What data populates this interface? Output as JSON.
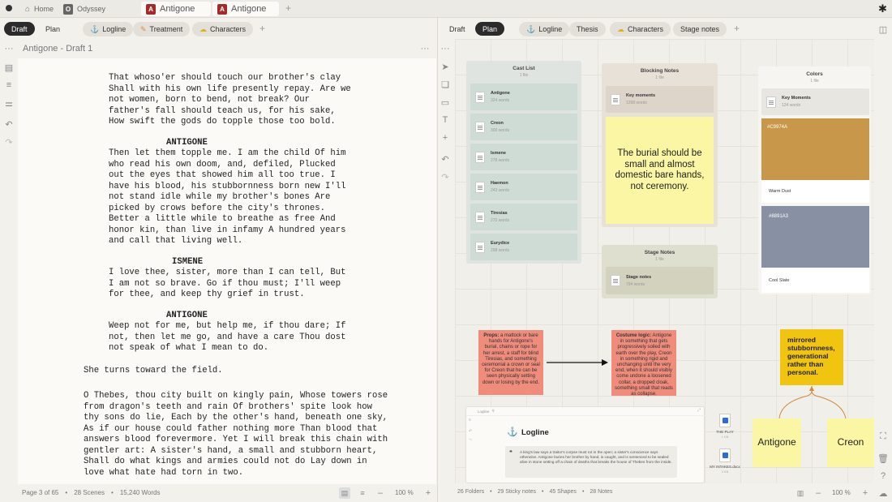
{
  "titlebar": {
    "tabs": [
      {
        "label": "Home",
        "icon": "home-icon"
      },
      {
        "label": "Odyssey",
        "icon": "o-doc-icon",
        "badge": "O"
      },
      {
        "label": "Antigone",
        "icon": "a-doc-icon",
        "badge": "A"
      },
      {
        "label": "Antigone",
        "icon": "a-doc-icon",
        "badge": "A"
      }
    ],
    "new_tab": "+"
  },
  "left_bar": {
    "draft": "Draft",
    "plan": "Plan",
    "tabs": [
      {
        "label": "Logline",
        "icon": "anchor-icon"
      },
      {
        "label": "Treatment",
        "icon": "pen-icon"
      },
      {
        "label": "Characters",
        "icon": "characters-icon"
      }
    ],
    "add": "+"
  },
  "right_bar": {
    "draft": "Draft",
    "plan": "Plan",
    "tabs": [
      {
        "label": "Logline",
        "icon": "anchor-icon"
      },
      {
        "label": "Thesis"
      },
      {
        "label": "Characters",
        "icon": "characters-icon"
      },
      {
        "label": "Stage notes"
      }
    ],
    "add": "+"
  },
  "editor": {
    "title": "Antigone - Draft 1",
    "blocks": [
      {
        "type": "dialogue",
        "text": "That whoso'er should touch our brother's clay\nShall with his own life presently repay. Are we\nnot women, born to bend, not break? Our\nfather's fall should teach us, for his sake,\nHow swift the gods do topple those too bold."
      },
      {
        "type": "character",
        "text": "ANTIGONE"
      },
      {
        "type": "dialogue",
        "text": "Then let them topple me. I am the child Of him\nwho read his own doom, and, defiled, Plucked\nout the eyes that showed him all too true. I\nhave his blood, his stubbornness born new I'll\nnot stand idle while my brother's bones Are\npicked by crows before the city's thrones.\nBetter a little while to breathe as free And\nhonor kin, than live in infamy A hundred years\nand call that living well."
      },
      {
        "type": "character",
        "text": "ISMENE"
      },
      {
        "type": "dialogue",
        "text": "I love thee, sister, more than I can tell, But\nI am not so brave. Go if thou must; I'll weep\nfor thee, and keep thy grief in trust."
      },
      {
        "type": "character",
        "text": "ANTIGONE"
      },
      {
        "type": "dialogue",
        "text": "Weep not for me, but help me, if thou dare; If\nnot, then let me go, and have a care Thou dost\nnot speak of what I mean to do."
      },
      {
        "type": "action",
        "text": "She turns toward the field."
      },
      {
        "type": "action",
        "text": "O Thebes, thou city built on kingly pain, Whose towers rose\nfrom dragon's teeth and rain Of brothers' spite look how\nthy sons do lie, Each by the other's hand, beneath one sky,\nAs if our house could father nothing more Than blood that\nanswers blood forevermore. Yet I will break this chain with\ngentler art: A sister's hand, a small and stubborn heart,\nShall do what kings and armies could not do Lay down in\nlove what hate had torn in two."
      }
    ]
  },
  "left_status": {
    "page": "Page 3 of 65",
    "scenes": "28 Scenes",
    "words": "15,240 Words",
    "zoom": "100 %"
  },
  "right_status": {
    "folders": "26 Folders",
    "sticky": "29 Sticky notes",
    "shapes": "45 Shapes",
    "notes": "28 Notes",
    "zoom": "100 %"
  },
  "canvas": {
    "cast_list": {
      "title": "Cast List",
      "sub": "1 file",
      "items": [
        {
          "name": "Antigone",
          "meta": "324 words"
        },
        {
          "name": "Creon",
          "meta": "300 words"
        },
        {
          "name": "Ismene",
          "meta": "278 words"
        },
        {
          "name": "Haemon",
          "meta": "243 words"
        },
        {
          "name": "Tiresias",
          "meta": "270 words"
        },
        {
          "name": "Eurydice",
          "meta": "298 words"
        }
      ]
    },
    "blocking": {
      "title": "Blocking Notes",
      "sub": "1 file",
      "item": {
        "name": "Key moments",
        "meta": "1298 words"
      },
      "sticky": "The burial should be small and almost domestic bare hands, not ceremony."
    },
    "stage_notes": {
      "title": "Stage Notes",
      "sub": "1 file",
      "item": {
        "name": "Stage notes",
        "meta": "794 words"
      }
    },
    "colors": {
      "title": "Colors",
      "sub": "1 file",
      "item": {
        "name": "Key Moments",
        "meta": "124 words"
      },
      "swatches": [
        {
          "hex": "#C9974A",
          "label": "Warm Dust",
          "color": "#C9974A"
        },
        {
          "hex": "#8891A3",
          "label": "Cool Slate",
          "color": "#8891A3"
        }
      ]
    },
    "props_note": {
      "bold": "Props:",
      "text": " a mattock or bare hands for Antigone's burial, chains or rope for her arrest, a staff for blind Tiresias, and something ceremonial a crown or seal for Creon that he can be seen physically setting down or losing by the end."
    },
    "costume_note": {
      "bold": "Costume logic:",
      "text": " Antigone in something that gets progressively soiled with earth over the play, Creon in something rigid and unchanging until the very end, when it should visibly come undone a loosened collar, a dropped cloak, something small that reads as collapse."
    },
    "theme_note": "mirrored stubbornness, generational rather than personal.",
    "antigone_label": "Antigone",
    "creon_label": "Creon",
    "logline_card": {
      "header": "Logline",
      "title": "Logline",
      "text": "A king's law says a traitor's corpse must rot in the open; a sister's conscience says otherwise. Antigone buries her brother by hand, is caught, and is sentenced to be sealed alive in stone setting off a chain of deaths that breaks the house of Thebes from the inside."
    },
    "files": [
      {
        "name": "THE PLAY",
        "meta": "1 KB"
      },
      {
        "name": "MY INTAKES.docx",
        "meta": "3 KB"
      }
    ]
  }
}
